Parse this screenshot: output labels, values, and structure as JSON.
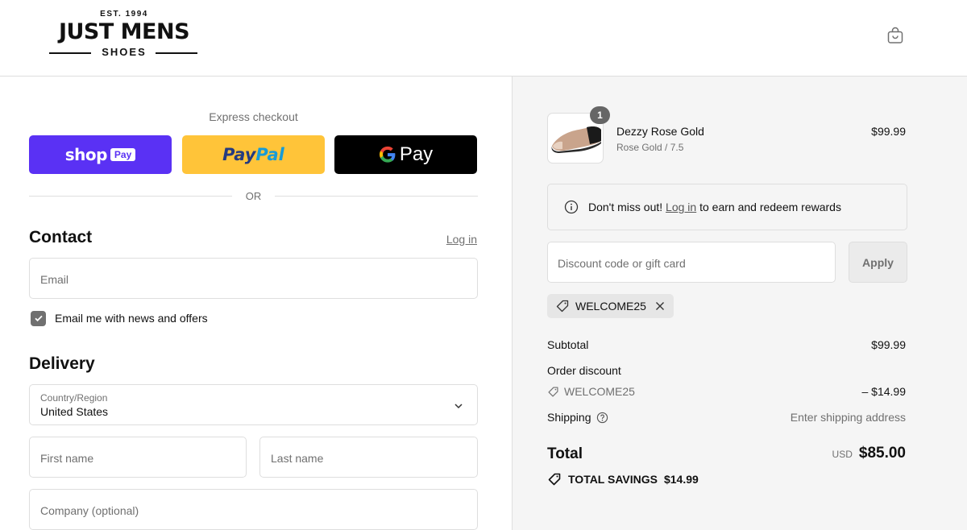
{
  "brand": {
    "est": "EST. 1994",
    "name": "JUST MENS",
    "subname": "SHOES"
  },
  "express": {
    "title": "Express checkout",
    "shop_word": "shop",
    "shop_badge": "Pay",
    "paypal_part1": "Pay",
    "paypal_part2": "Pal",
    "gpay_word": "Pay",
    "or_label": "OR"
  },
  "contact": {
    "title": "Contact",
    "login_label": "Log in",
    "email_placeholder": "Email",
    "newsletter_label": "Email me with news and offers",
    "newsletter_checked": true
  },
  "delivery": {
    "title": "Delivery",
    "country_label": "Country/Region",
    "country_value": "United States",
    "first_name_placeholder": "First name",
    "last_name_placeholder": "Last name",
    "company_placeholder": "Company (optional)"
  },
  "order": {
    "quantity": "1",
    "product_name": "Dezzy Rose Gold",
    "product_variant": "Rose Gold / 7.5",
    "product_price": "$99.99",
    "rewards_prefix": "Don't miss out!",
    "rewards_link": "Log in",
    "rewards_suffix": "to earn and redeem rewards",
    "discount_placeholder": "Discount code or gift card",
    "apply_label": "Apply",
    "applied_code": "WELCOME25",
    "subtotal_label": "Subtotal",
    "subtotal_value": "$99.99",
    "order_discount_label": "Order discount",
    "discount_code": "WELCOME25",
    "discount_value": "– $14.99",
    "shipping_label": "Shipping",
    "shipping_value": "Enter shipping address",
    "total_label": "Total",
    "currency": "USD",
    "total_value": "$85.00",
    "savings_label": "TOTAL SAVINGS",
    "savings_value": "$14.99"
  },
  "colors": {
    "shop_pay": "#5a31f4",
    "paypal": "#ffc439",
    "gpay": "#000000",
    "summary_bg": "#f5f5f5"
  }
}
